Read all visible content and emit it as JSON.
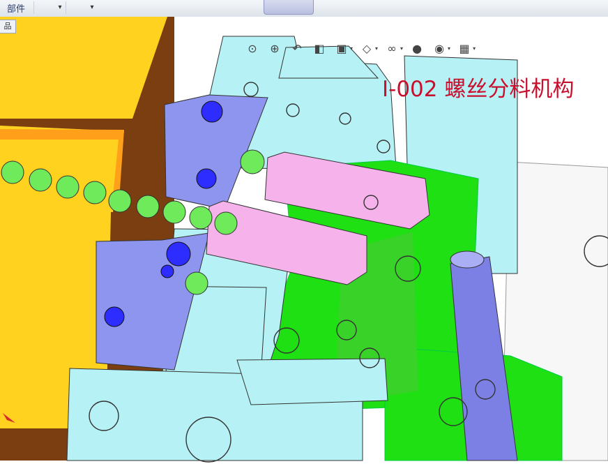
{
  "toolbar": {
    "part_label": "部件",
    "dropdown_arrow": "▾",
    "side_tab_label": "品"
  },
  "view_toolbar": {
    "icons": [
      "zoom-fit-icon",
      "zoom-area-icon",
      "previous-view-icon",
      "section-view-icon",
      "view-orientation-icon",
      "display-style-icon",
      "hide-show-icon",
      "appearance-icon",
      "scene-icon",
      "view-settings-icon"
    ]
  },
  "canvas": {
    "title": "I-002 螺丝分料机构"
  },
  "colors": {
    "yellow_plate": "#ffd21f",
    "brown_base": "#7a3e10",
    "cyan_block": "#b6f2f5",
    "green_plate": "#1fe012",
    "blue_block": "#8d95ee",
    "pink_slider": "#f6b2ea",
    "title_red": "#c8102e"
  }
}
